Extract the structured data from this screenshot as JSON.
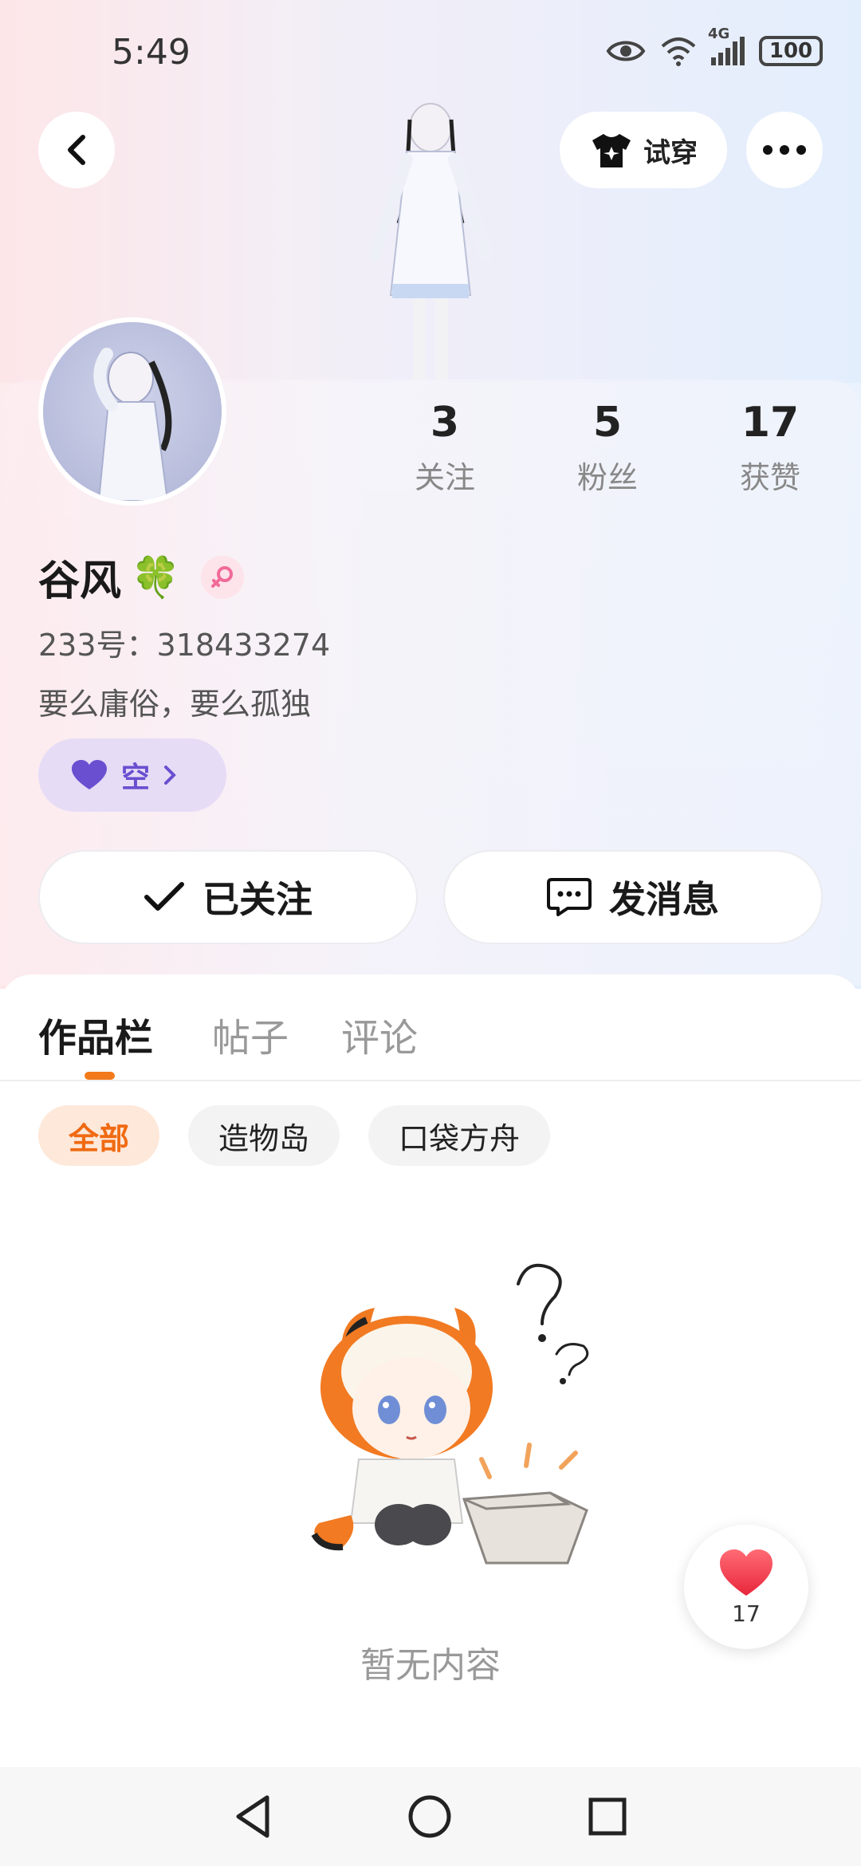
{
  "status_bar": {
    "time": "5:49",
    "network": "4G",
    "battery": "100"
  },
  "header": {
    "try_on_label": "试穿"
  },
  "profile": {
    "name": "谷风",
    "name_emoji": "🍀",
    "uid_text": "233号：318433274",
    "bio": "要么庸俗，要么孤独",
    "badge_label": "空"
  },
  "stats": [
    {
      "value": "3",
      "label": "关注"
    },
    {
      "value": "5",
      "label": "粉丝"
    },
    {
      "value": "17",
      "label": "获赞"
    }
  ],
  "actions": {
    "follow_label": "已关注",
    "message_label": "发消息"
  },
  "tabs": [
    {
      "label": "作品栏",
      "active": true
    },
    {
      "label": "帖子",
      "active": false
    },
    {
      "label": "评论",
      "active": false
    }
  ],
  "chips": [
    {
      "label": "全部",
      "active": true
    },
    {
      "label": "造物岛",
      "active": false
    },
    {
      "label": "口袋方舟",
      "active": false
    }
  ],
  "empty_state": {
    "text": "暂无内容"
  },
  "like_float": {
    "count": "17"
  },
  "colors": {
    "accent": "#f27a1a",
    "badge_purple": "#6a4fd0",
    "heart": "#f03e50"
  }
}
